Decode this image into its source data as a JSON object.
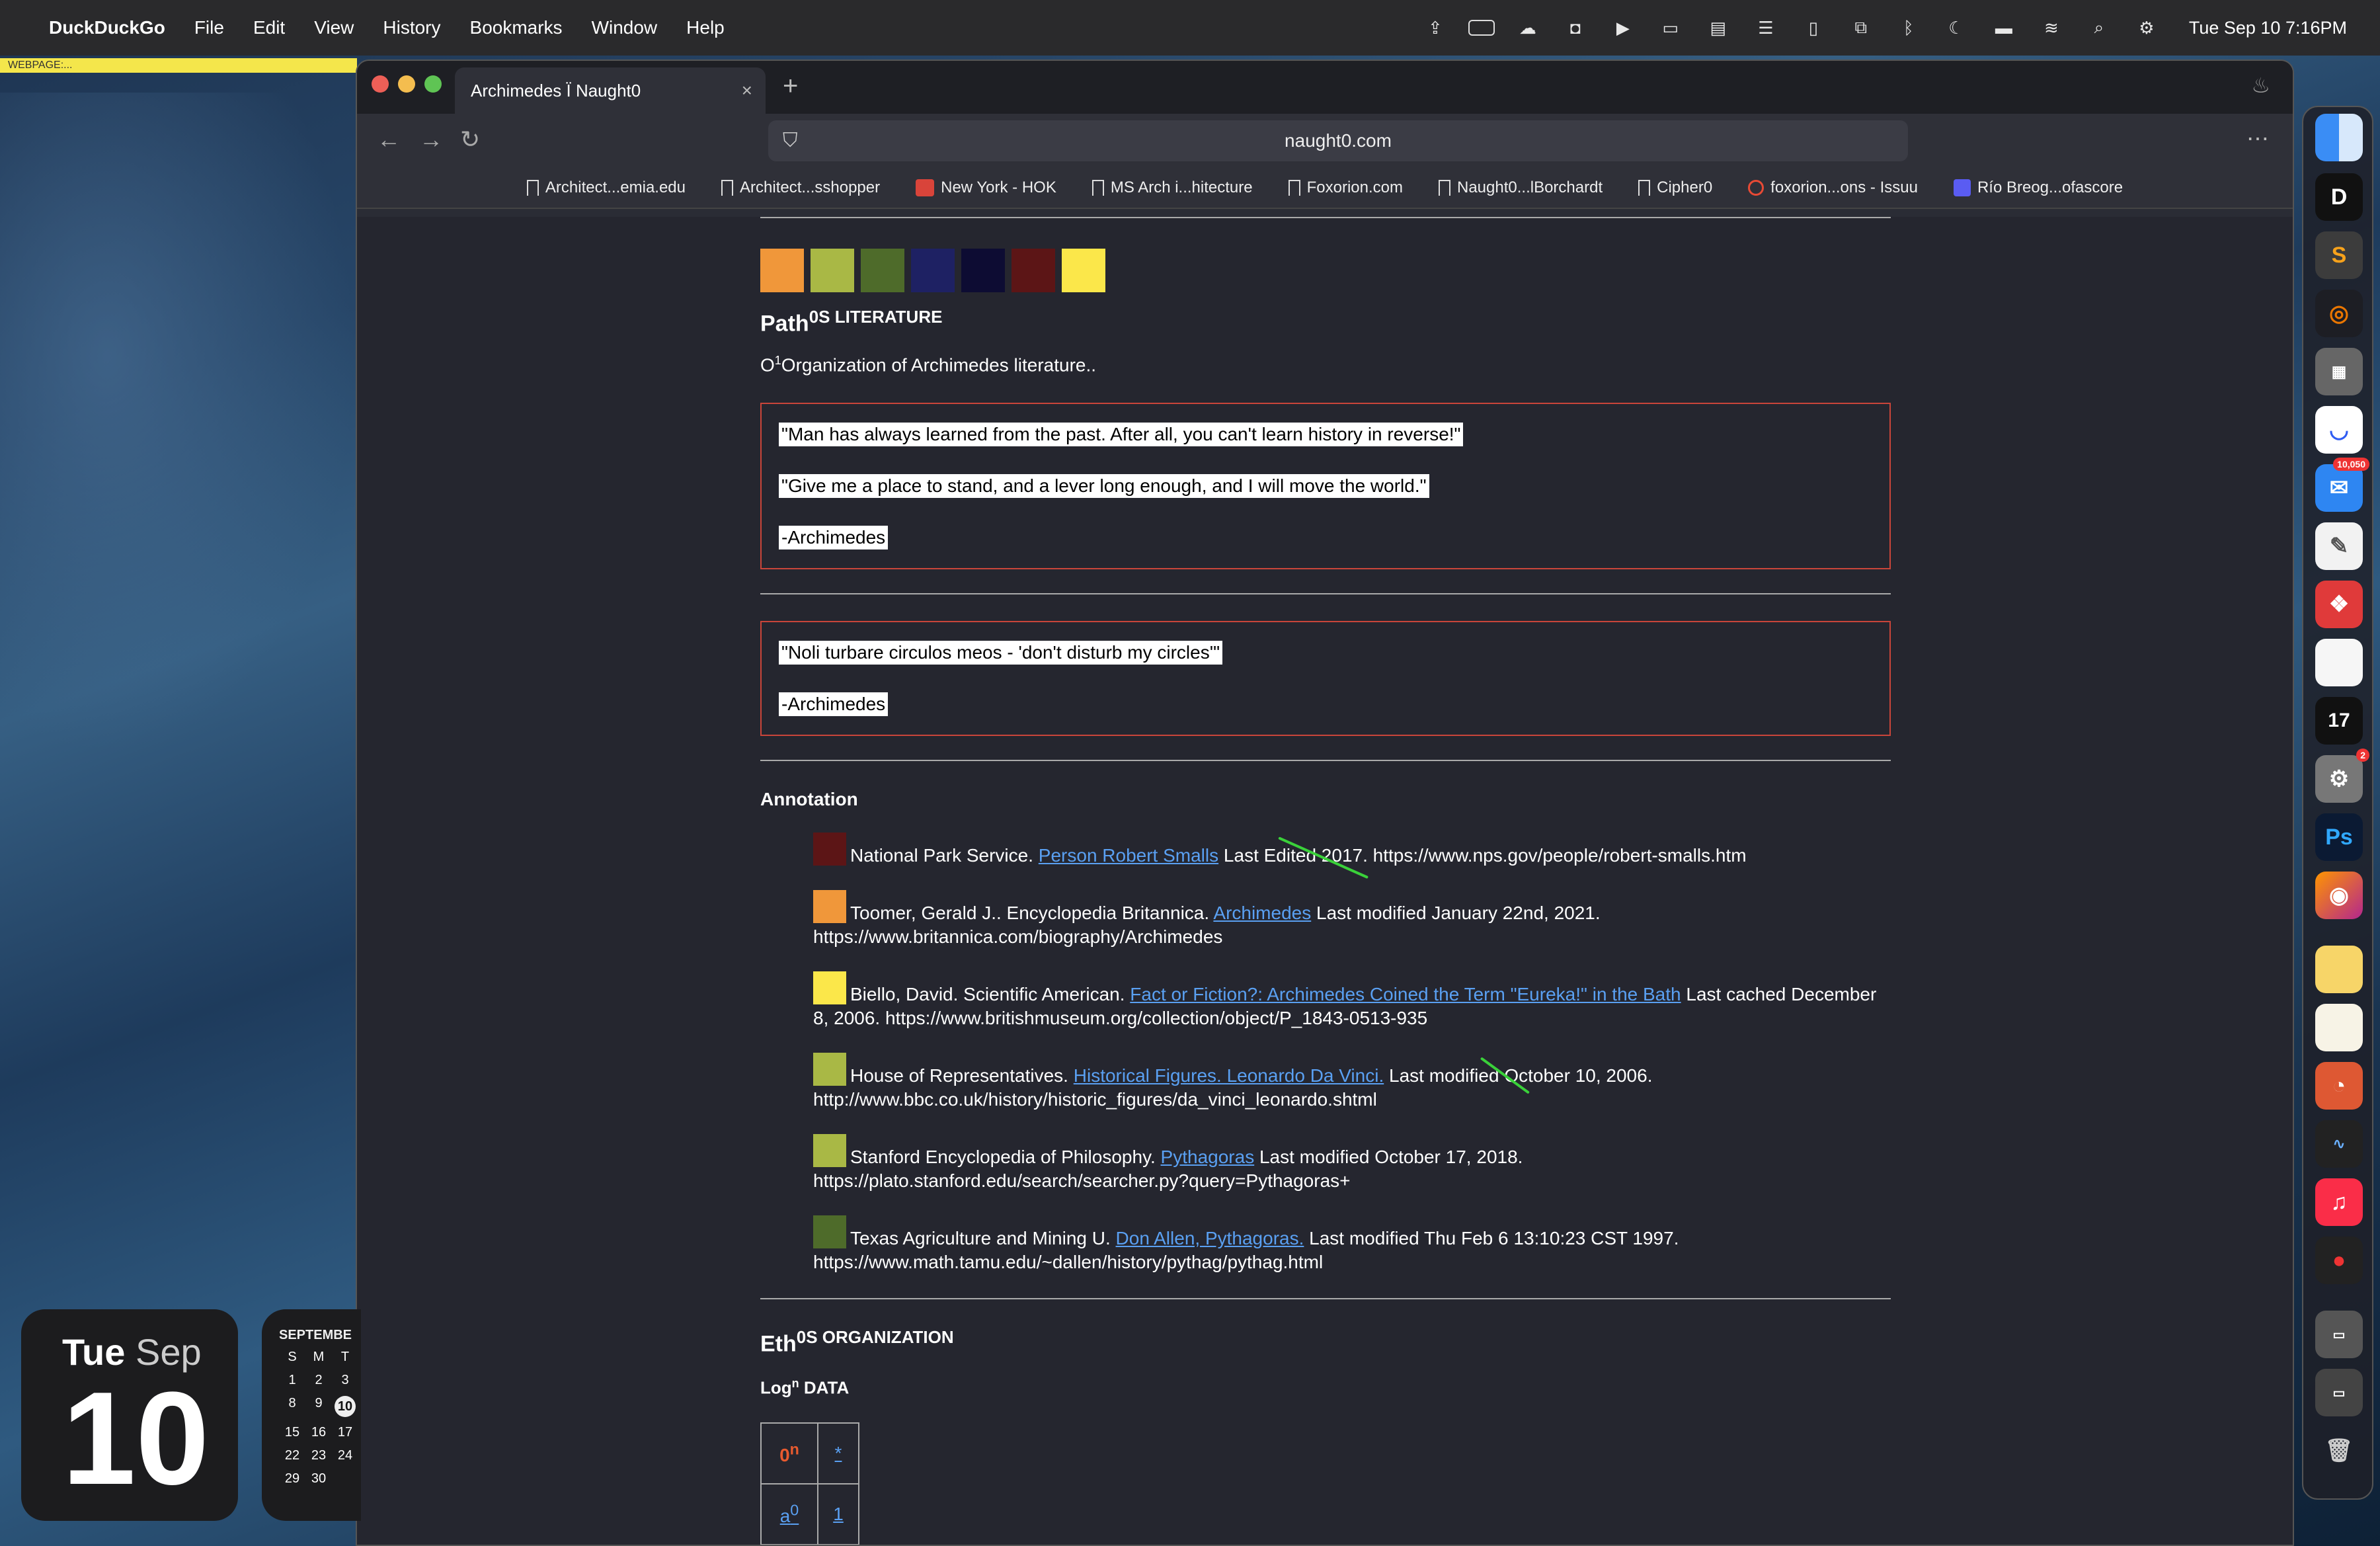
{
  "menubar": {
    "app_name": "DuckDuckGo",
    "menus": [
      "File",
      "Edit",
      "View",
      "History",
      "Bookmarks",
      "Window",
      "Help"
    ],
    "clock": "Tue Sep 10  7:16PM"
  },
  "desktop": {
    "webpage_flag": "WEBPAGE:..."
  },
  "browser": {
    "tab_title": "Archimedes Ï Naught0",
    "url": "naught0.com",
    "bookmarks": [
      "Architect...emia.edu",
      "Architect...sshopper",
      "New York - HOK",
      "MS Arch i...hitecture",
      "Foxorion.com",
      "Naught0...lBorchardt",
      "Cipher0",
      "foxorion...ons - Issuu",
      "Río Breog...ofascore"
    ]
  },
  "page": {
    "swatch_colors": [
      "#f0973a",
      "#a9b845",
      "#4e6b2a",
      "#1e2163",
      "#0d0c33",
      "#5c1516",
      "#fbe74a"
    ],
    "path_heading": "Path",
    "path_heading_sup": "0S LITERATURE",
    "path_subtitle_prefix": "O",
    "path_subtitle_sup": "1",
    "path_subtitle": "Organization of Archimedes literature..",
    "quotes_box1": [
      "\"Man has always learned from the past. After all, you can't learn history in reverse!\"",
      "\"Give me a place to stand, and a lever long enough, and I will move the world.\"",
      "-Archimedes"
    ],
    "quotes_box2": [
      "\"Noli turbare circulos meos - 'don't disturb my circles'\"",
      "-Archimedes"
    ],
    "annotation_heading": "Annotation",
    "references": [
      {
        "color": "#5c1516",
        "pre": "National Park Service. ",
        "link": "Person Robert Smalls",
        "post": " Last Edited 2017. https://www.nps.gov/people/robert-smalls.htm"
      },
      {
        "color": "#f0973a",
        "pre": "Toomer, Gerald J.. Encyclopedia Britannica. ",
        "link": "Archimedes",
        "post": " Last modified January 22nd, 2021. https://www.britannica.com/biography/Archimedes"
      },
      {
        "color": "#fbe74a",
        "pre": "Biello, David. Scientific American. ",
        "link": "Fact or Fiction?: Archimedes Coined the Term \"Eureka!\" in the Bath",
        "post": " Last cached December 8, 2006. https://www.britishmuseum.org/collection/object/P_1843-0513-935"
      },
      {
        "color": "#a9b845",
        "pre": "House of Representatives. ",
        "link": "Historical Figures. Leonardo Da Vinci.",
        "post": " Last modified October 10, 2006. http://www.bbc.co.uk/history/historic_figures/da_vinci_leonardo.shtml"
      },
      {
        "color": "#a9b845",
        "pre": "Stanford Encyclopedia of Philosophy. ",
        "link": "Pythagoras",
        "post": " Last modified October 17, 2018. https://plato.stanford.edu/search/searcher.py?query=Pythagoras+"
      },
      {
        "color": "#4e6b2a",
        "pre": "Texas Agriculture and Mining U. ",
        "link": "Don Allen, Pythagoras.",
        "post": " Last modified Thu Feb 6 13:10:23 CST 1997. https://www.math.tamu.edu/~dallen/history/pythag/pythag.html"
      }
    ],
    "eth_heading": "Eth",
    "eth_heading_sup": "0S ORGANIZATION",
    "log_heading": "Log",
    "log_heading_sup": "n",
    "log_heading_rest": " DATA",
    "log_table": {
      "r1c1": "0",
      "r1c1_sup": "n",
      "r1c2": "*",
      "r2c1": "a",
      "r2c1_sup": "0",
      "r2c2": "1"
    }
  },
  "dock": {
    "mail_badge": "10,050",
    "settings_badge": "2"
  },
  "widgets": {
    "date_day": "Tue",
    "date_month": "Sep",
    "date_num": "10",
    "calendar_month": "SEPTEMBE",
    "calendar_header": [
      "S",
      "M",
      "T"
    ],
    "calendar_rows": [
      [
        "1",
        "2",
        "3"
      ],
      [
        "8",
        "9",
        "10"
      ],
      [
        "15",
        "16",
        "17"
      ],
      [
        "22",
        "23",
        "24"
      ],
      [
        "29",
        "30",
        ""
      ]
    ]
  }
}
